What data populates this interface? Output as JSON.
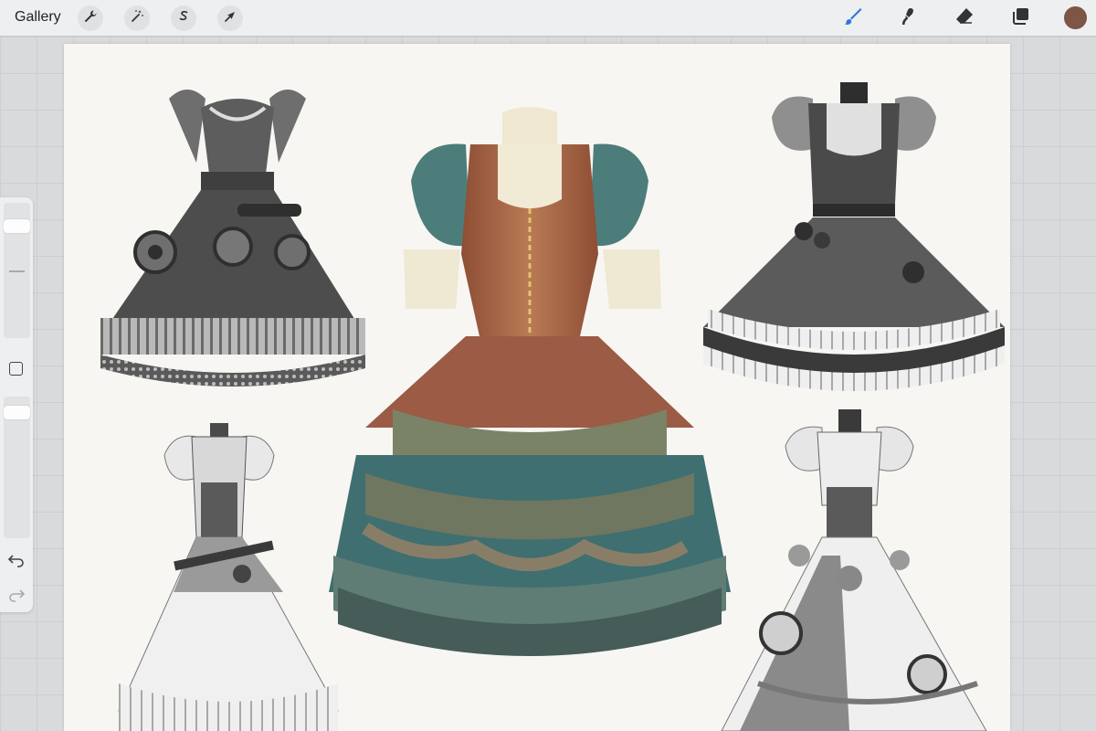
{
  "toolbar": {
    "gallery_label": "Gallery",
    "left_icons": [
      "wrench-icon",
      "magic-wand-icon",
      "selection-s-icon",
      "transform-arrow-icon"
    ],
    "right_icons": [
      "brush-icon",
      "smudge-icon",
      "eraser-icon",
      "layers-icon"
    ],
    "active_tool": "brush",
    "accent_color": "#2f79d6",
    "current_color": "#7f5546"
  },
  "sidebar": {
    "brush_size_level": 0.95,
    "opacity_level": 0.95,
    "icons": [
      "modify-square-icon",
      "undo-icon",
      "redo-icon"
    ]
  },
  "canvas": {
    "background": "#f8f6f2",
    "artwork": [
      {
        "name": "grey-steampunk-dress-gears",
        "colors": [
          "#3b3b3b",
          "#777",
          "#aaa"
        ]
      },
      {
        "name": "colored-steampunk-corset-dress",
        "colors": [
          "#a8684a",
          "#3f6f70",
          "#7b8367",
          "#efe7cf"
        ]
      },
      {
        "name": "grey-ruffled-dress-roses",
        "colors": [
          "#2e2e2e",
          "#8a8a8a",
          "#e7e7e7"
        ]
      },
      {
        "name": "grey-white-gown-belts",
        "colors": [
          "#4a4a4a",
          "#bdbdbd",
          "#f0f0f0"
        ]
      },
      {
        "name": "grey-gown-wheels-roses",
        "colors": [
          "#3a3a3a",
          "#9b9b9b",
          "#ececec"
        ]
      }
    ]
  }
}
